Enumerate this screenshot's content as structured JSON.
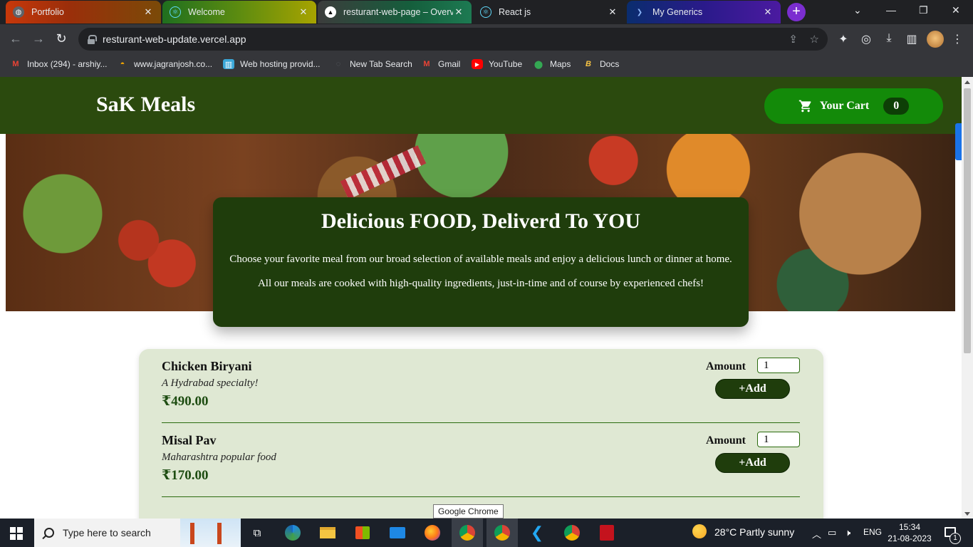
{
  "browser": {
    "tabs": [
      {
        "title": "Portfolio"
      },
      {
        "title": "Welcome"
      },
      {
        "title": "resturant-web-page – Overvi"
      },
      {
        "title": "React js"
      },
      {
        "title": "My Generics"
      }
    ],
    "url": "resturant-web-update.vercel.app",
    "bookmarks": [
      {
        "label": "Inbox (294) - arshiy..."
      },
      {
        "label": "www.jagranjosh.co..."
      },
      {
        "label": "Web hosting provid..."
      },
      {
        "label": "New Tab Search"
      },
      {
        "label": "Gmail"
      },
      {
        "label": "YouTube"
      },
      {
        "label": "Maps"
      },
      {
        "label": "Docs"
      }
    ]
  },
  "page": {
    "brand": "SaK Meals",
    "cart": {
      "label": "Your Cart",
      "count": "0"
    },
    "intro": {
      "title": "Delicious FOOD, Deliverd To YOU",
      "p1": "Choose your favorite meal from our broad selection of available meals and enjoy a delicious lunch or dinner at home.",
      "p2": "All our meals are cooked with high-quality ingredients, just-in-time and of course by experienced chefs!"
    },
    "meals": [
      {
        "name": "Chicken Biryani",
        "desc": "A Hydrabad specialty!",
        "price": "₹490.00",
        "amount_label": "Amount",
        "amount": "1",
        "add_label": "+Add"
      },
      {
        "name": "Misal Pav",
        "desc": "Maharashtra popular food",
        "price": "₹170.00",
        "amount_label": "Amount",
        "amount": "1",
        "add_label": "+Add"
      }
    ]
  },
  "tooltip": "Google Chrome",
  "taskbar": {
    "search_placeholder": "Type here to search",
    "weather": "28°C  Partly sunny",
    "lang": "ENG",
    "time": "15:34",
    "date": "21-08-2023",
    "notifications": "1"
  },
  "colors": {
    "header": "#2b4a0e",
    "cart_button": "#138a09",
    "intro_card": "#1f3d0c",
    "meals_card": "#dfe8d3",
    "price": "#1e4d12"
  }
}
